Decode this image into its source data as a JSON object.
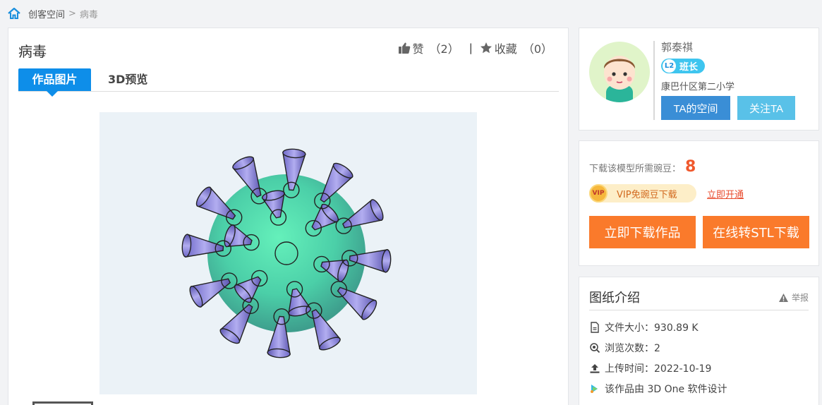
{
  "breadcrumb": {
    "home_icon": "home-icon",
    "space": "创客空间",
    "separator": ">",
    "current": "病毒"
  },
  "work": {
    "title": "病毒",
    "like_label": "赞",
    "like_count": "（2）",
    "fav_label": "收藏",
    "fav_count": "（0）",
    "separator": "|"
  },
  "tabs": [
    {
      "label": "作品图片",
      "active": true
    },
    {
      "label": "3D预览",
      "active": false
    }
  ],
  "author": {
    "name": "郭泰祺",
    "level": "L2",
    "role": "班长",
    "school": "康巴什区第二小学",
    "space_button": "TA的空间",
    "follow_button": "关注TA"
  },
  "download": {
    "need_label": "下载该模型所需豌豆：",
    "need_value": "8",
    "vip_badge": "VIP",
    "vip_text": "VIP免豌豆下载",
    "open_link": "立即开通",
    "download_button": "立即下载作品",
    "stl_button": "在线转STL下载"
  },
  "intro": {
    "title": "图纸介绍",
    "report": "举报",
    "file_size": "文件大小：930.89 K",
    "views": "浏览次数：2",
    "upload": "上传时间：2022-10-19",
    "software": "该作品由 3D One 软件设计"
  },
  "colors": {
    "accent_blue": "#0e8ee9",
    "download_orange": "#fa7a2b",
    "price_red": "#f0582c"
  }
}
